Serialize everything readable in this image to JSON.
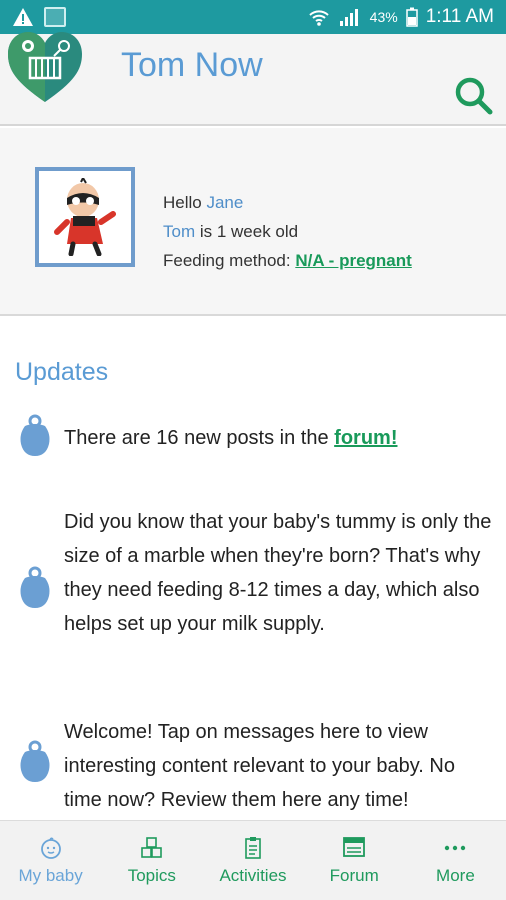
{
  "status_bar": {
    "battery": "43%",
    "time": "1:11 AM"
  },
  "app_bar": {
    "title": "Tom Now"
  },
  "profile": {
    "hello_prefix": "Hello ",
    "user_name": "Jane",
    "baby_name": "Tom",
    "age_text": " is 1 week old",
    "feeding_label": "Feeding method: ",
    "feeding_value": "N/A - pregnant"
  },
  "updates": {
    "heading": "Updates",
    "items": [
      {
        "text": "There are 16 new posts in the ",
        "link": "forum!"
      },
      {
        "text": "Did you know that your baby's tummy is only the size of a marble when they're born? That's why they need feeding 8-12 times a day, which also helps set up your milk supply."
      },
      {
        "text": "Welcome! Tap on messages here to view interesting content relevant to your baby. No time now? Review them here any time!"
      }
    ]
  },
  "bottom_nav": {
    "items": [
      {
        "label": "My baby",
        "icon": "baby-face-icon"
      },
      {
        "label": "Topics",
        "icon": "blocks-icon"
      },
      {
        "label": "Activities",
        "icon": "clipboard-icon"
      },
      {
        "label": "Forum",
        "icon": "forum-icon"
      },
      {
        "label": "More",
        "icon": "more-dots-icon"
      }
    ]
  },
  "colors": {
    "status_bar": "#1e9aa0",
    "title_blue": "#5a9bd4",
    "link_green": "#199a5a",
    "nav_green": "#1f9a5d",
    "nav_active": "#6aa5d8"
  }
}
